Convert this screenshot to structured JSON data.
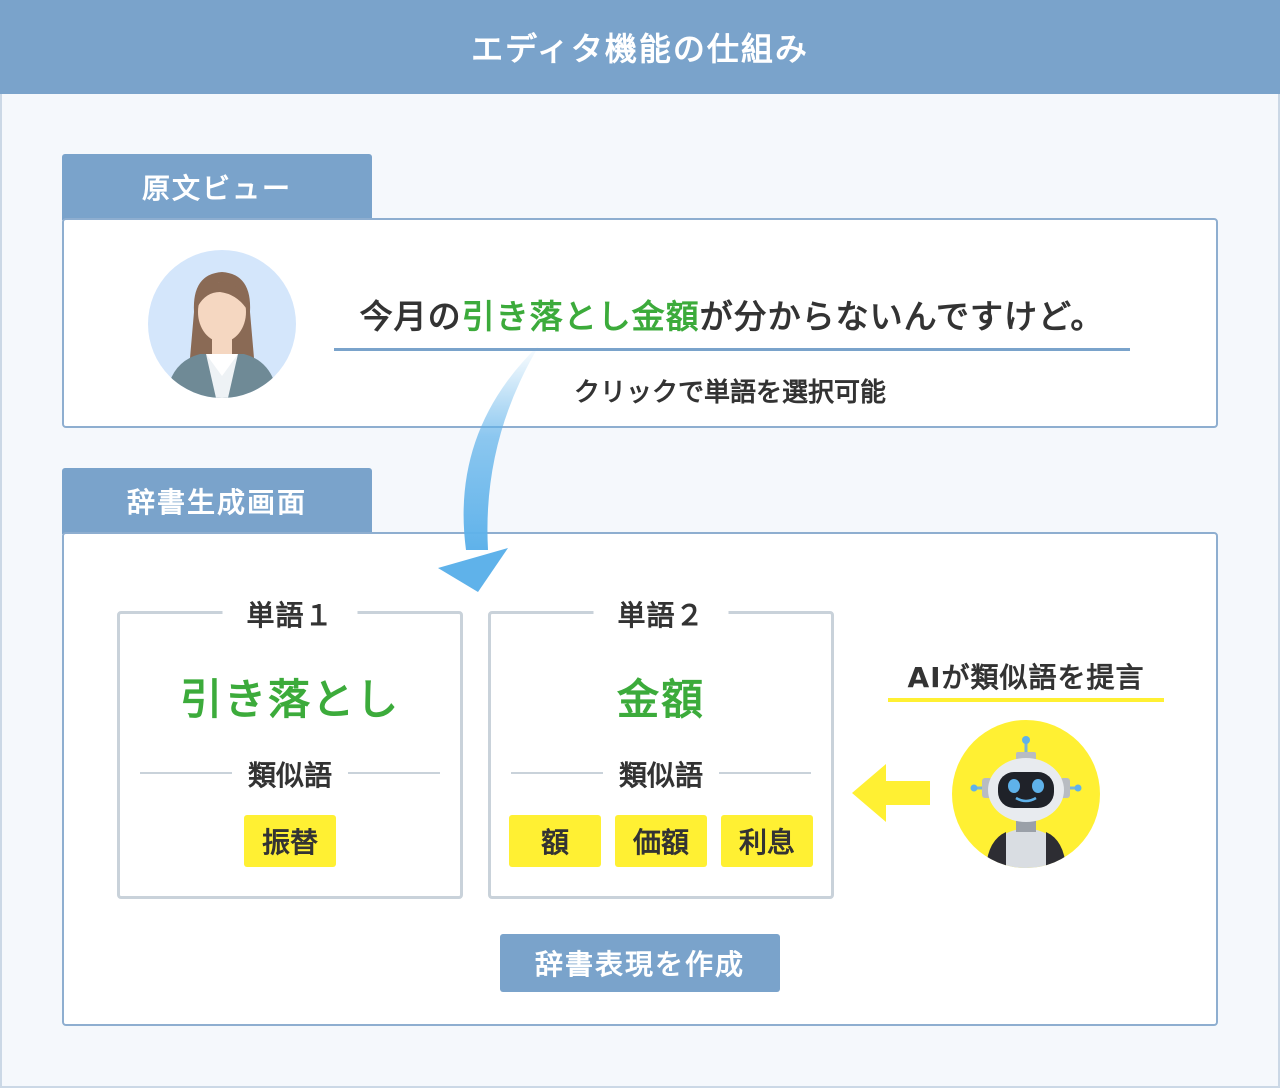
{
  "header": {
    "title": "エディタ機能の仕組み"
  },
  "original_view": {
    "tab_label": "原文ビュー",
    "sentence_parts": [
      {
        "text": "今月の",
        "highlight": false
      },
      {
        "text": "引き落とし金額",
        "highlight": true
      },
      {
        "text": "が分からないんですけど。",
        "highlight": false
      }
    ],
    "click_note": "クリックで単語を選択可能"
  },
  "dictionary_screen": {
    "tab_label": "辞書生成画面",
    "words": [
      {
        "title": "単語１",
        "word": "引き落とし",
        "synonyms_label": "類似語",
        "synonyms": [
          "振替"
        ]
      },
      {
        "title": "単語２",
        "word": "金額",
        "synonyms_label": "類似語",
        "synonyms": [
          "額",
          "価額",
          "利息"
        ]
      }
    ],
    "ai_label": "AIが類似語を提言",
    "create_button": "辞書表現を作成"
  },
  "icons": {
    "avatar": "woman-avatar-icon",
    "robot": "ai-robot-icon",
    "curve_arrow": "curved-arrow-icon",
    "left_arrow": "arrow-left-icon"
  },
  "colors": {
    "primary": "#7aa3cb",
    "highlight_green": "#3cab3b",
    "chip_yellow": "#fff033",
    "avatar_bg": "#d4e6fb",
    "arrow_blue": "#5fb2ea"
  }
}
